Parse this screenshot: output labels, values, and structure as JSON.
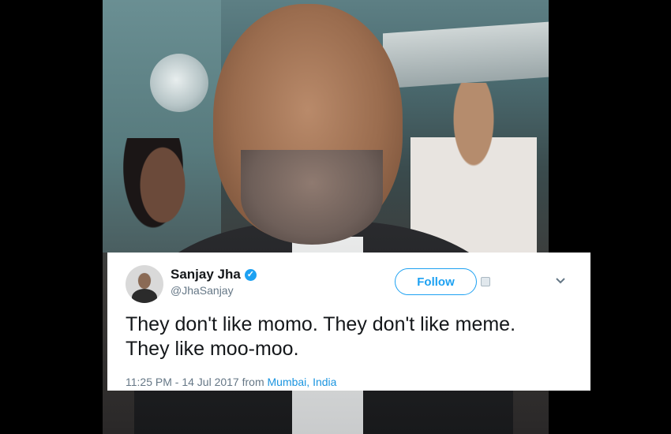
{
  "tweet": {
    "name": "Sanjay Jha",
    "handle": "@JhaSanjay",
    "follow_label": "Follow",
    "text_line1": "They don't like momo. They don't like meme.",
    "text_line2": "They like moo-moo.",
    "timestamp": "11:25 PM - 14 Jul 2017 from",
    "location": "Mumbai, India",
    "verified": true
  },
  "colors": {
    "accent": "#1da1f2",
    "text": "#14171a",
    "muted": "#657786",
    "background": "#000000"
  },
  "icons": {
    "verified": "verified-badge-icon",
    "dropdown": "chevron-down-icon",
    "extra": "image-icon"
  }
}
